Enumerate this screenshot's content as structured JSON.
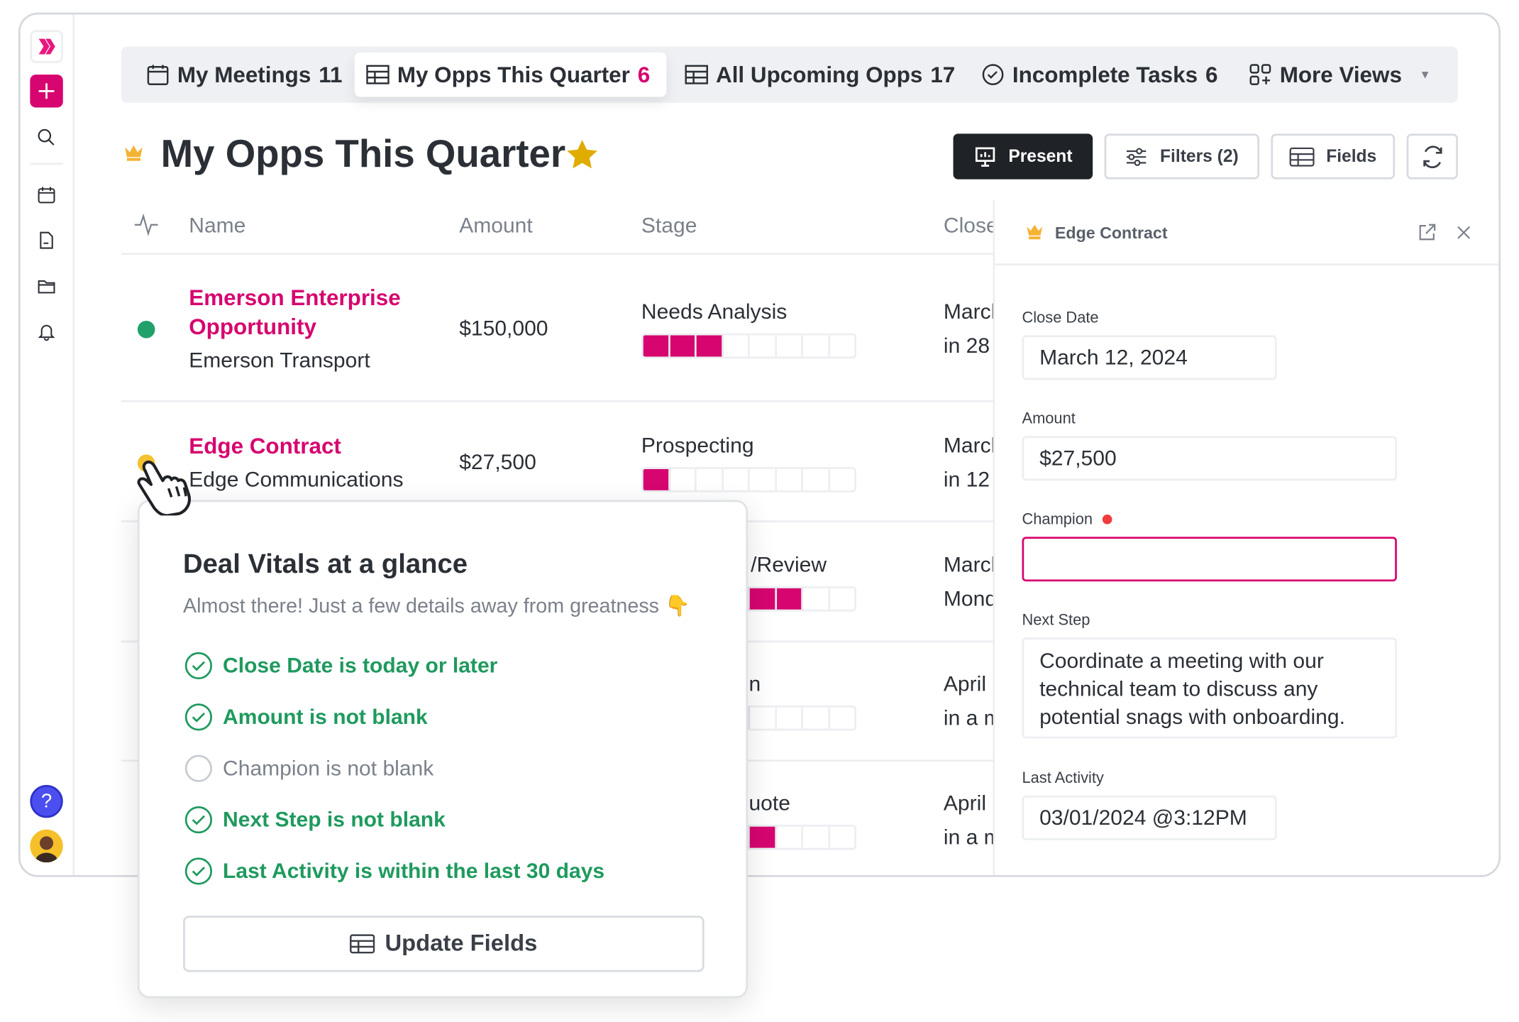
{
  "colors": {
    "accent": "#d6056f",
    "success": "#1f9a5e",
    "star": "#e0ac00",
    "crown": "#f5b335",
    "help": "#4b4ff0",
    "required": "#f03c3c"
  },
  "sidebar": {
    "icons": [
      "logo-icon",
      "plus-icon",
      "search-icon",
      "calendar-icon",
      "document-icon",
      "folder-icon",
      "bell-icon",
      "help-icon",
      "avatar"
    ],
    "help_label": "?"
  },
  "tabs": [
    {
      "label": "My Meetings",
      "count": "11",
      "icon": "calendar-icon"
    },
    {
      "label": "My Opps This Quarter",
      "count": "6",
      "icon": "table-icon",
      "active": true
    },
    {
      "label": "All Upcoming Opps",
      "count": "17",
      "icon": "table-icon"
    },
    {
      "label": "Incomplete Tasks",
      "count": "6",
      "icon": "check-circle-icon"
    },
    {
      "label": "More Views",
      "count": "",
      "icon": "grid-plus-icon"
    }
  ],
  "header": {
    "title": "My Opps This Quarter",
    "present": "Present",
    "filters": "Filters (2)",
    "fields": "Fields"
  },
  "table": {
    "columns": [
      "Name",
      "Amount",
      "Stage",
      "Close"
    ],
    "rows": [
      {
        "name_l1": "Emerson Enterprise",
        "name_l2": "Opportunity",
        "company": "Emerson Transport",
        "amount": "$150,000",
        "stage": "Needs Analysis",
        "progress": 3,
        "close_l1": "March",
        "close_l2": "in 28",
        "status": "#22a06b"
      },
      {
        "name_l1": "Edge Contract",
        "company": "Edge Communications",
        "amount": "$27,500",
        "stage": "Prospecting",
        "progress": 1,
        "close_l1": "March",
        "close_l2": "in 12",
        "status": "#f2c230"
      },
      {
        "stage": "/Review",
        "progress": 6,
        "close_l1": "March",
        "close_l2": "Mond"
      },
      {
        "stage": "n",
        "progress": 4,
        "close_l1": "April",
        "close_l2": "in a m"
      },
      {
        "stage": "uote",
        "progress": 5,
        "close_l1": "April",
        "close_l2": "in a m"
      }
    ],
    "segments": 8
  },
  "panel": {
    "title": "Edge Contract",
    "fields": [
      {
        "label": "Close Date",
        "value": "March 12, 2024"
      },
      {
        "label": "Amount",
        "value": "$27,500"
      },
      {
        "label": "Champion",
        "value": "",
        "required": true
      },
      {
        "label": "Next Step",
        "value": "Coordinate a meeting with our technical team to discuss any potential snags with onboarding."
      },
      {
        "label": "Last Activity",
        "value": "03/01/2024 @3:12PM"
      }
    ]
  },
  "popup": {
    "title": "Deal Vitals at a glance",
    "subtitle": "Almost there! Just a few details away from greatness 👇",
    "checks": [
      {
        "label": "Close Date is today or later",
        "done": true
      },
      {
        "label": "Amount is not blank",
        "done": true
      },
      {
        "label": "Champion is not blank",
        "done": false
      },
      {
        "label": "Next Step is not blank",
        "done": true
      },
      {
        "label": "Last Activity is within the last 30 days",
        "done": true
      }
    ],
    "button": "Update Fields"
  }
}
